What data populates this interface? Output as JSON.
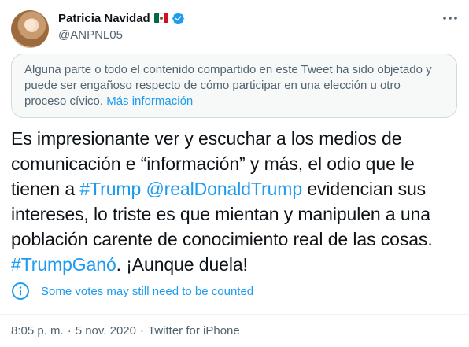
{
  "author": {
    "display_name": "Patricia Navidad",
    "handle": "@ANPNL05",
    "flag": "mexico-flag-icon",
    "verified": true
  },
  "notice": {
    "text": "Alguna parte o todo el contenido compartido en este Tweet ha sido objetado y puede ser engañoso respecto de cómo participar en una elección u otro proceso cívico.",
    "link_label": "Más información"
  },
  "tweet": {
    "segments": [
      {
        "text": "Es impresionante ver y escuchar a los medios de comunicación e “información” y más, el odio que le tienen a ",
        "link": false
      },
      {
        "text": "#Trump",
        "link": true
      },
      {
        "text": " ",
        "link": false
      },
      {
        "text": "@realDonaldTrump",
        "link": true
      },
      {
        "text": " evidencian sus intereses, lo triste es que mientan y manipulen a una población carente de conocimiento real de las cosas. ",
        "link": false
      },
      {
        "text": "#TrumpGanó",
        "link": true
      },
      {
        "text": ". ¡Aunque duela!",
        "link": false
      }
    ]
  },
  "votes_notice": {
    "label": "Some votes may still need to be counted",
    "icon": "info-circle-icon"
  },
  "meta": {
    "time": "8:05 p. m.",
    "separator": "·",
    "date": "5 nov. 2020",
    "source": "Twitter for iPhone"
  },
  "colors": {
    "accent": "#1d9bf0",
    "secondary_text": "#536471",
    "primary_text": "#0f1419"
  }
}
